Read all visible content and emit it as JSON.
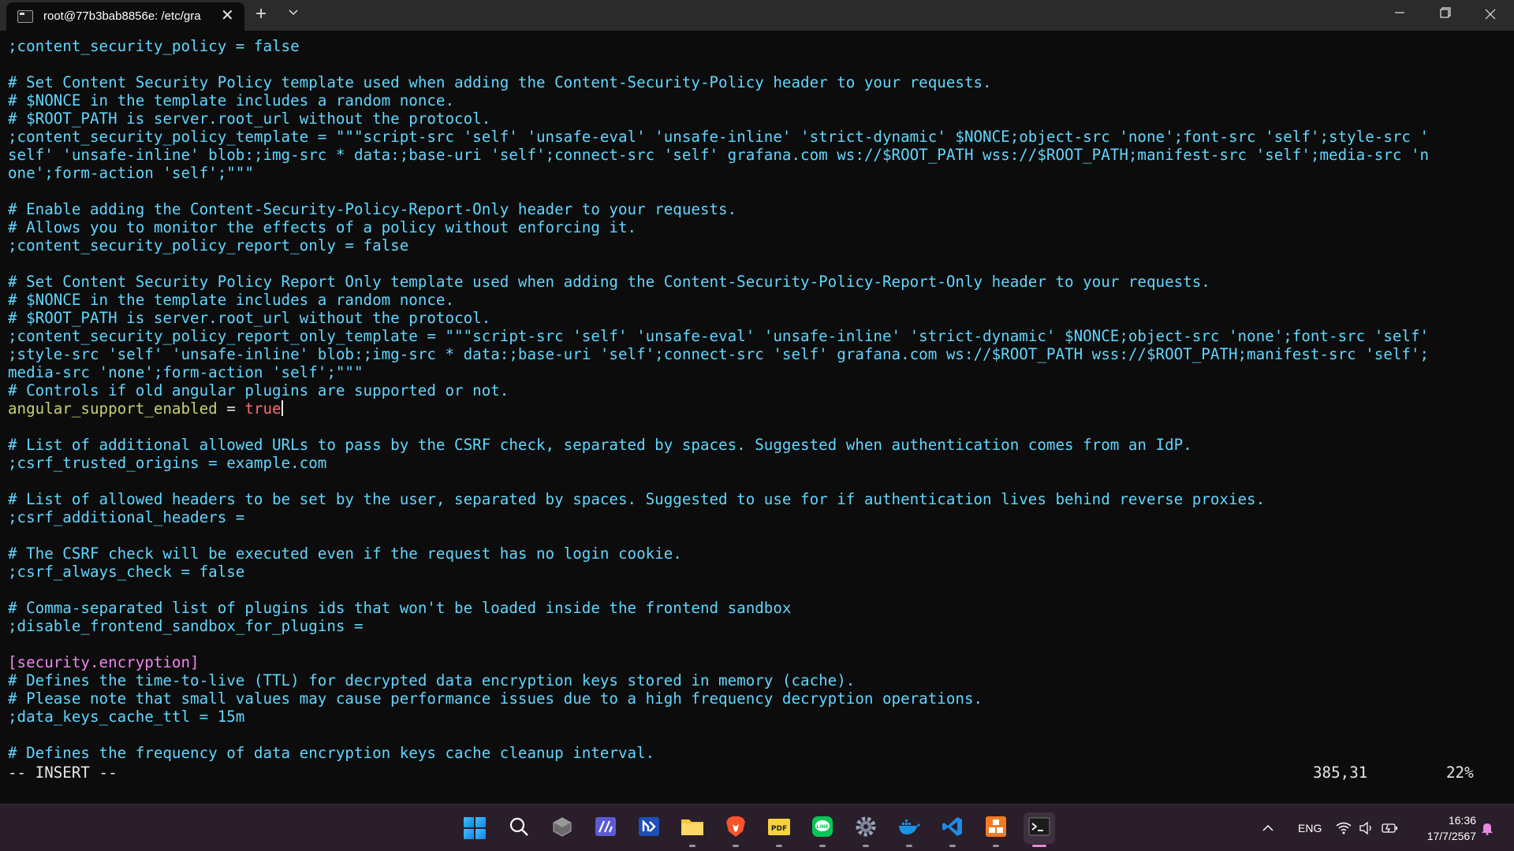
{
  "window": {
    "tab_title": "root@77b3bab8856e: /etc/gra",
    "new_tab_symbol": "+",
    "dropdown_symbol": "⌄",
    "close_tab_symbol": "✕",
    "minimize_symbol": "—",
    "maximize_symbol": "❐",
    "close_symbol": "✕"
  },
  "editor": {
    "lines": [
      {
        "t": ";content_security_policy = false",
        "c": "comment"
      },
      {
        "t": "",
        "c": "plain"
      },
      {
        "t": "# Set Content Security Policy template used when adding the Content-Security-Policy header to your requests.",
        "c": "comment"
      },
      {
        "t": "# $NONCE in the template includes a random nonce.",
        "c": "comment"
      },
      {
        "t": "# $ROOT_PATH is server.root_url without the protocol.",
        "c": "comment"
      },
      {
        "t": ";content_security_policy_template = \"\"\"script-src 'self' 'unsafe-eval' 'unsafe-inline' 'strict-dynamic' $NONCE;object-src 'none';font-src 'self';style-src '",
        "c": "comment"
      },
      {
        "t": "self' 'unsafe-inline' blob:;img-src * data:;base-uri 'self';connect-src 'self' grafana.com ws://$ROOT_PATH wss://$ROOT_PATH;manifest-src 'self';media-src 'n",
        "c": "comment"
      },
      {
        "t": "one';form-action 'self';\"\"\"",
        "c": "comment"
      },
      {
        "t": "",
        "c": "plain"
      },
      {
        "t": "# Enable adding the Content-Security-Policy-Report-Only header to your requests.",
        "c": "comment"
      },
      {
        "t": "# Allows you to monitor the effects of a policy without enforcing it.",
        "c": "comment"
      },
      {
        "t": ";content_security_policy_report_only = false",
        "c": "comment"
      },
      {
        "t": "",
        "c": "plain"
      },
      {
        "t": "# Set Content Security Policy Report Only template used when adding the Content-Security-Policy-Report-Only header to your requests.",
        "c": "comment"
      },
      {
        "t": "# $NONCE in the template includes a random nonce.",
        "c": "comment"
      },
      {
        "t": "# $ROOT_PATH is server.root_url without the protocol.",
        "c": "comment"
      },
      {
        "t": ";content_security_policy_report_only_template = \"\"\"script-src 'self' 'unsafe-eval' 'unsafe-inline' 'strict-dynamic' $NONCE;object-src 'none';font-src 'self'",
        "c": "comment"
      },
      {
        "t": ";style-src 'self' 'unsafe-inline' blob:;img-src * data:;base-uri 'self';connect-src 'self' grafana.com ws://$ROOT_PATH wss://$ROOT_PATH;manifest-src 'self';",
        "c": "comment"
      },
      {
        "t": "media-src 'none';form-action 'self';\"\"\"",
        "c": "comment"
      },
      {
        "t": "# Controls if old angular plugins are supported or not.",
        "c": "comment"
      },
      {
        "t": "",
        "c": "kv",
        "key": "angular_support_enabled",
        "eq": " = ",
        "val": "true"
      },
      {
        "t": "",
        "c": "plain"
      },
      {
        "t": "# List of additional allowed URLs to pass by the CSRF check, separated by spaces. Suggested when authentication comes from an IdP.",
        "c": "comment"
      },
      {
        "t": ";csrf_trusted_origins = example.com",
        "c": "comment"
      },
      {
        "t": "",
        "c": "plain"
      },
      {
        "t": "# List of allowed headers to be set by the user, separated by spaces. Suggested to use for if authentication lives behind reverse proxies.",
        "c": "comment"
      },
      {
        "t": ";csrf_additional_headers =",
        "c": "comment"
      },
      {
        "t": "",
        "c": "plain"
      },
      {
        "t": "# The CSRF check will be executed even if the request has no login cookie.",
        "c": "comment"
      },
      {
        "t": ";csrf_always_check = false",
        "c": "comment"
      },
      {
        "t": "",
        "c": "plain"
      },
      {
        "t": "# Comma-separated list of plugins ids that won't be loaded inside the frontend sandbox",
        "c": "comment"
      },
      {
        "t": ";disable_frontend_sandbox_for_plugins =",
        "c": "comment"
      },
      {
        "t": "",
        "c": "plain"
      },
      {
        "t": "[security.encryption]",
        "c": "section"
      },
      {
        "t": "# Defines the time-to-live (TTL) for decrypted data encryption keys stored in memory (cache).",
        "c": "comment"
      },
      {
        "t": "# Please note that small values may cause performance issues due to a high frequency decryption operations.",
        "c": "comment"
      },
      {
        "t": ";data_keys_cache_ttl = 15m",
        "c": "comment"
      },
      {
        "t": "",
        "c": "plain"
      },
      {
        "t": "# Defines the frequency of data encryption keys cache cleanup interval.",
        "c": "comment"
      }
    ],
    "status": {
      "mode": "-- INSERT --",
      "position": "385,31",
      "percent": "22%"
    }
  },
  "taskbar": {
    "apps": [
      {
        "name": "start-button",
        "icon": "windows-logo-icon",
        "active": false,
        "running": false
      },
      {
        "name": "search-button",
        "icon": "search-icon",
        "active": false,
        "running": false
      },
      {
        "name": "taskbar-app-1",
        "icon": "cube-icon",
        "active": false,
        "running": false
      },
      {
        "name": "taskbar-app-2",
        "icon": "slash-app-icon",
        "active": false,
        "running": false
      },
      {
        "name": "taskbar-app-3",
        "icon": "mx-app-icon",
        "active": false,
        "running": false
      },
      {
        "name": "file-explorer",
        "icon": "folder-icon",
        "active": false,
        "running": true
      },
      {
        "name": "brave-browser",
        "icon": "brave-lion-icon",
        "active": false,
        "running": true
      },
      {
        "name": "pdf-app",
        "icon": "pdf-icon",
        "active": false,
        "running": true
      },
      {
        "name": "line-app",
        "icon": "line-chat-icon",
        "active": false,
        "running": true
      },
      {
        "name": "settings-app",
        "icon": "gear-icon",
        "active": false,
        "running": true
      },
      {
        "name": "docker-app",
        "icon": "docker-whale-icon",
        "active": false,
        "running": true
      },
      {
        "name": "vscode-app",
        "icon": "vscode-icon",
        "active": false,
        "running": true
      },
      {
        "name": "taskbar-app-orange",
        "icon": "orange-boxes-icon",
        "active": false,
        "running": true
      },
      {
        "name": "terminal-app",
        "icon": "terminal-icon",
        "active": true,
        "running": true
      }
    ],
    "tray": {
      "chevron": "^",
      "language": "ENG",
      "time": "16:36",
      "date": "17/7/2567"
    }
  },
  "colors": {
    "comment": "#61d6ff",
    "section": "#f084f0",
    "key": "#c8d070",
    "value": "#ff6b6b",
    "background": "#0c0c0c"
  }
}
